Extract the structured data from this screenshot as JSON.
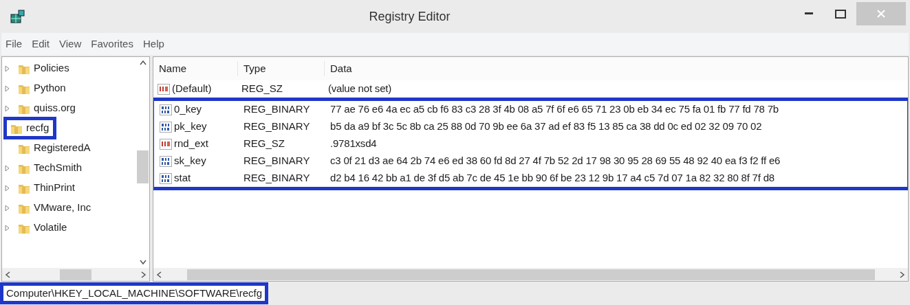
{
  "window": {
    "title": "Registry Editor"
  },
  "menu": [
    "File",
    "Edit",
    "View",
    "Favorites",
    "Help"
  ],
  "tree": [
    {
      "label": "Policies",
      "expandable": true,
      "annotated": false
    },
    {
      "label": "Python",
      "expandable": true,
      "annotated": false
    },
    {
      "label": "quiss.org",
      "expandable": true,
      "annotated": false
    },
    {
      "label": "recfg",
      "expandable": false,
      "annotated": true
    },
    {
      "label": "RegisteredA",
      "expandable": false,
      "annotated": false
    },
    {
      "label": "TechSmith",
      "expandable": true,
      "annotated": false
    },
    {
      "label": "ThinPrint",
      "expandable": true,
      "annotated": false
    },
    {
      "label": "VMware, Inc",
      "expandable": true,
      "annotated": false
    },
    {
      "label": "Volatile",
      "expandable": true,
      "annotated": false
    }
  ],
  "table": {
    "columns": [
      "Name",
      "Type",
      "Data"
    ],
    "rows": [
      {
        "kind": "string",
        "name": "(Default)",
        "type": "REG_SZ",
        "data": "(value not set)",
        "annotated": false
      },
      {
        "kind": "binary",
        "name": "0_key",
        "type": "REG_BINARY",
        "data": "77 ae 76 e6 4a ec a5 cb f6 83 c3 28 3f 4b 08 a5 7f 6f e6 65 71 23 0b eb 34 ec 75 fa 01 fb 77 fd 78 7b",
        "annotated": true
      },
      {
        "kind": "binary",
        "name": "pk_key",
        "type": "REG_BINARY",
        "data": "b5 da a9 bf 3c 5c 8b ca 25 88 0d 70 9b ee 6a 37 ad ef 83 f5 13 85 ca 38 dd 0c ed 02 32 09 70 02",
        "annotated": true
      },
      {
        "kind": "string",
        "name": "rnd_ext",
        "type": "REG_SZ",
        "data": ".9781xsd4",
        "annotated": true
      },
      {
        "kind": "binary",
        "name": "sk_key",
        "type": "REG_BINARY",
        "data": "c3 0f 21 d3 ae 64 2b 74 e6 ed 38 60 fd 8d 27 4f 7b 52 2d 17 98 30 95 28 69 55 48 92 40 ea f3 f2 ff e6",
        "annotated": true
      },
      {
        "kind": "binary",
        "name": "stat",
        "type": "REG_BINARY",
        "data": "d2 b4 16 42 bb a1 de 3f d5 ab 7c de 45 1e bb 90 6f be 23 12 9b 17 a4 c5 7d 07 1a 82 32 80 8f 7f d8",
        "annotated": true
      }
    ]
  },
  "status_bar": {
    "path": "Computer\\HKEY_LOCAL_MACHINE\\SOFTWARE\\recfg",
    "annotated": true
  }
}
